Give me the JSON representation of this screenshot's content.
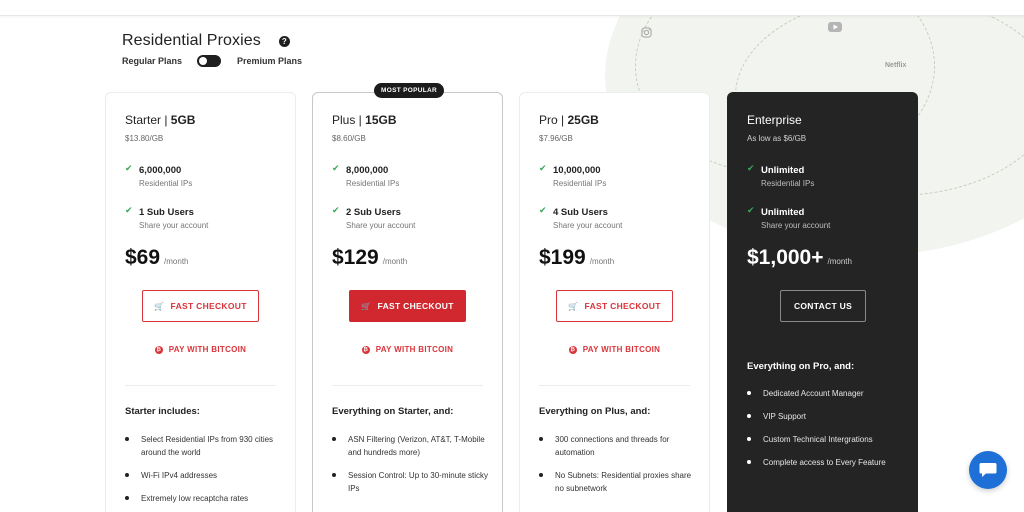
{
  "header": {
    "title": "Residential Proxies",
    "toggle_left": "Regular Plans",
    "toggle_right": "Premium Plans"
  },
  "background": {
    "netflix_label": "Netflix"
  },
  "colors": {
    "accent_red": "#d0282e",
    "check_green": "#3aa757",
    "dark_card": "#242424",
    "chat_blue": "#1e6fd6"
  },
  "plans": [
    {
      "name": "Starter | ",
      "size": "5GB",
      "per_gb": "$13.80/GB",
      "features": [
        {
          "title": "6,000,000",
          "sub": "Residential IPs"
        },
        {
          "title": "1 Sub Users",
          "sub": "Share your account"
        }
      ],
      "price": "$69",
      "per": "/month",
      "cta": "FAST CHECKOUT",
      "bitcoin": "PAY WITH BITCOIN",
      "includes_title": "Starter includes:",
      "includes": [
        "Select Residential IPs from 930 cities around the world",
        "Wi-Fi IPv4 addresses",
        "Extremely low recaptcha rates"
      ]
    },
    {
      "badge": "MOST POPULAR",
      "name": "Plus | ",
      "size": "15GB",
      "per_gb": "$8.60/GB",
      "features": [
        {
          "title": "8,000,000",
          "sub": "Residential IPs"
        },
        {
          "title": "2 Sub Users",
          "sub": "Share your account"
        }
      ],
      "price": "$129",
      "per": "/month",
      "cta": "FAST CHECKOUT",
      "bitcoin": "PAY WITH BITCOIN",
      "includes_title": "Everything on Starter, and:",
      "includes": [
        "ASN Filtering (Verizon, AT&T, T-Mobile and hundreds more)",
        "Session Control: Up to 30-minute sticky IPs"
      ]
    },
    {
      "name": "Pro | ",
      "size": "25GB",
      "per_gb": "$7.96/GB",
      "features": [
        {
          "title": "10,000,000",
          "sub": "Residential IPs"
        },
        {
          "title": "4 Sub Users",
          "sub": "Share your account"
        }
      ],
      "price": "$199",
      "per": "/month",
      "cta": "FAST CHECKOUT",
      "bitcoin": "PAY WITH BITCOIN",
      "includes_title": "Everything on Plus, and:",
      "includes": [
        "300 connections and threads for automation",
        "No Subnets: Residential proxies share no subnetwork"
      ]
    },
    {
      "name": "Enterprise",
      "size": "",
      "per_gb": "As low as $6/GB",
      "features": [
        {
          "title": "Unlimited",
          "sub": "Residential IPs"
        },
        {
          "title": "Unlimited",
          "sub": "Share your account"
        }
      ],
      "price": "$1,000+",
      "per": "/month",
      "cta": "CONTACT US",
      "includes_title": "Everything on Pro, and:",
      "includes": [
        "Dedicated Account Manager",
        "VIP Support",
        "Custom Technical Intergrations",
        "Complete access to Every Feature"
      ]
    }
  ]
}
